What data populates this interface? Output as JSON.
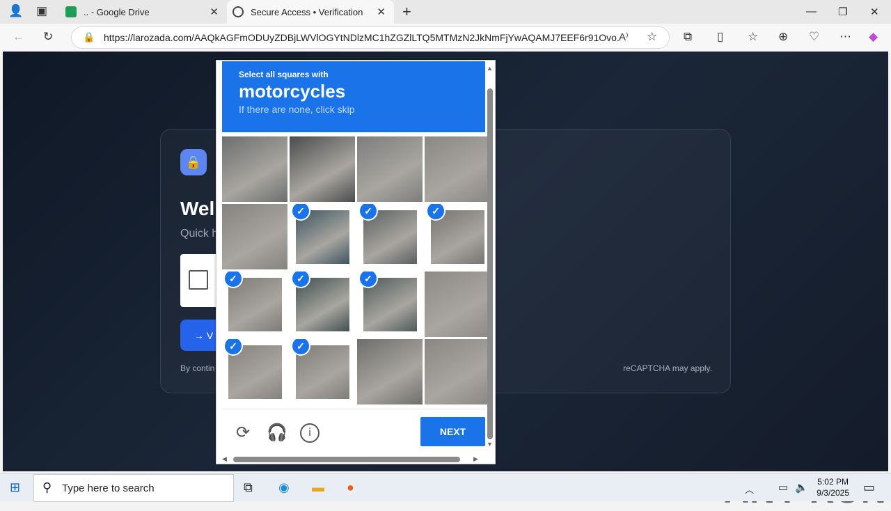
{
  "browser": {
    "tabs": [
      {
        "title": ".. - Google Drive"
      },
      {
        "title": "Secure Access • Verification"
      }
    ],
    "url": "https://larozada.com/AAQkAGFmODUyZDBjLWVlOGYtNDlzMC1hZGZlLTQ5MTMzN2JkNmFjYwAQAMJ7EEF6r91Ovo...",
    "colors": {
      "accent": "#1a73e8"
    }
  },
  "page": {
    "welcome": "Wel",
    "quick": "Quick h",
    "verify_btn": "→  V",
    "by_continuing": "By contin",
    "recaptcha_note": "reCAPTCHA may apply.",
    "watermark": "ANY RUN"
  },
  "captcha": {
    "instruction_small": "Select all squares with",
    "instruction_big": "motorcycles",
    "instruction_hint": "If there are none, click skip",
    "tiles": [
      {
        "selected": false
      },
      {
        "selected": false
      },
      {
        "selected": false
      },
      {
        "selected": false
      },
      {
        "selected": false
      },
      {
        "selected": true
      },
      {
        "selected": true
      },
      {
        "selected": true
      },
      {
        "selected": true
      },
      {
        "selected": true
      },
      {
        "selected": true
      },
      {
        "selected": false
      },
      {
        "selected": true
      },
      {
        "selected": true
      },
      {
        "selected": false
      },
      {
        "selected": false
      }
    ],
    "next_label": "NEXT",
    "footer_icons": [
      "reload-icon",
      "audio-icon",
      "info-icon"
    ]
  },
  "taskbar": {
    "search_placeholder": "Type here to search",
    "time": "5:02 PM",
    "date": "9/3/2025"
  }
}
